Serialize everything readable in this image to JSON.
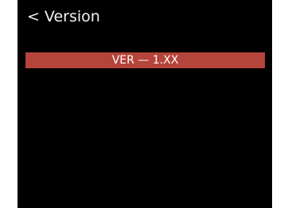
{
  "header": {
    "back_glyph": "<",
    "title": "Version"
  },
  "version_item": {
    "label": "VER — 1.XX",
    "highlight_color": "#b5443a"
  }
}
